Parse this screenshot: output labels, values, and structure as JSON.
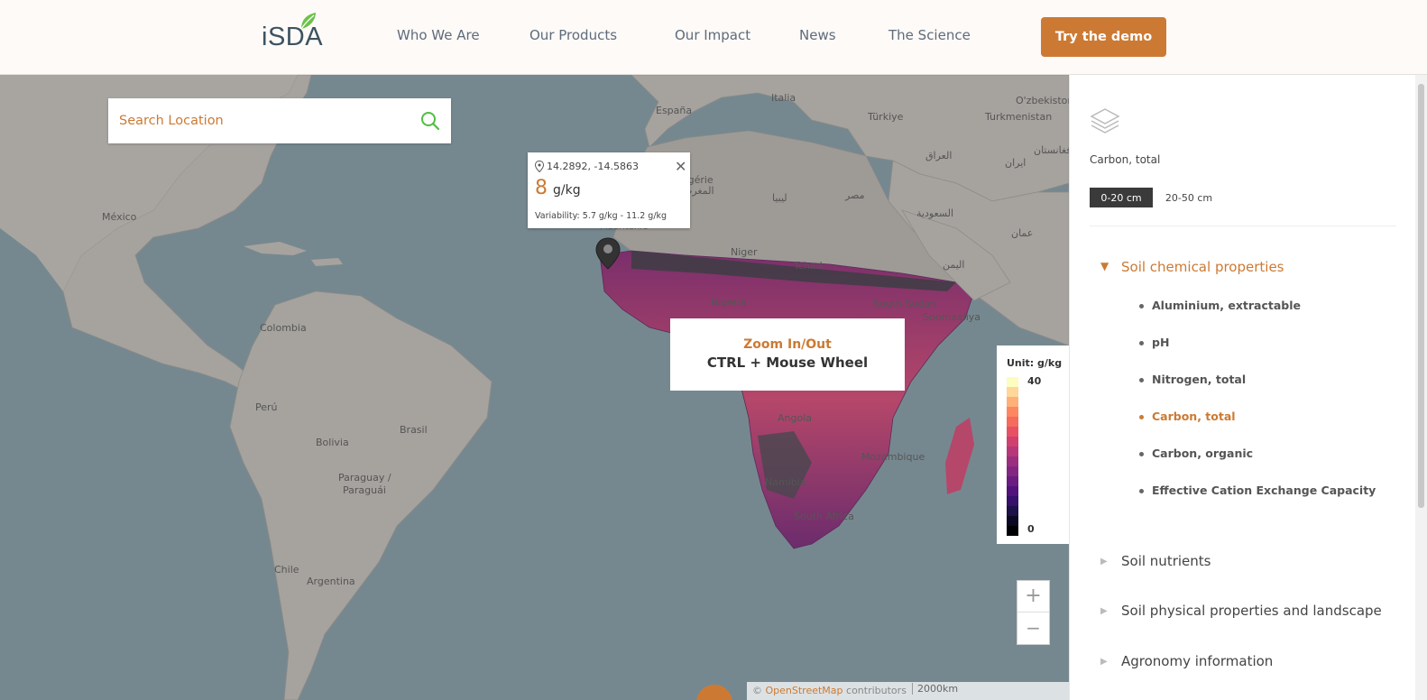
{
  "header": {
    "logo_text": "iSDA",
    "nav": [
      "Who We Are",
      "Our Products",
      "Our Impact",
      "News",
      "The Science"
    ],
    "cta": "Try the demo"
  },
  "search": {
    "placeholder": "Search Location",
    "icon": "search-icon"
  },
  "map_labels": [
    {
      "text": "Italia",
      "id": "italia"
    },
    {
      "text": "España",
      "id": "espana"
    },
    {
      "text": "Türkiye",
      "id": "turkiye"
    },
    {
      "text": "O'zbekiston",
      "id": "uzbek"
    },
    {
      "text": "Turkmenistan",
      "id": "turkmen"
    },
    {
      "text": "México",
      "id": "mexico"
    },
    {
      "text": "Colombia",
      "id": "colombia"
    },
    {
      "text": "Perú",
      "id": "peru"
    },
    {
      "text": "Bolivia",
      "id": "bolivia"
    },
    {
      "text": "Brasil",
      "id": "brasil"
    },
    {
      "text": "Paraguay /",
      "id": "paraguay1"
    },
    {
      "text": "Paraguái",
      "id": "paraguay2"
    },
    {
      "text": "Chile",
      "id": "chile"
    },
    {
      "text": "Argentina",
      "id": "argentina"
    },
    {
      "text": "ليبيا",
      "id": "libya"
    },
    {
      "text": "مصر",
      "id": "egypt"
    },
    {
      "text": "العراق",
      "id": "iraq"
    },
    {
      "text": "ایران",
      "id": "iran"
    },
    {
      "text": "افغانستان",
      "id": "afghan"
    },
    {
      "text": "السعودية",
      "id": "saudi"
    },
    {
      "text": "عمان",
      "id": "oman"
    },
    {
      "text": "اليمن",
      "id": "yemen"
    },
    {
      "text": "Algérie",
      "id": "algerie"
    },
    {
      "text": "المغرب",
      "id": "morocco"
    },
    {
      "text": "Mauritanie",
      "id": "mauritanie"
    },
    {
      "text": "Niger",
      "id": "niger"
    },
    {
      "text": "Tchad",
      "id": "tchad"
    },
    {
      "text": "South Sudan",
      "id": "southsudan"
    },
    {
      "text": "Soomaaliya",
      "id": "somalia"
    },
    {
      "text": "Nigeria",
      "id": "nigeria"
    },
    {
      "text": "Angola",
      "id": "angola"
    },
    {
      "text": "Namibia",
      "id": "namibia"
    },
    {
      "text": "South Africa",
      "id": "southafrica"
    },
    {
      "text": "Mozambique",
      "id": "mozambique"
    }
  ],
  "popup": {
    "coords": "14.2892, -14.5863",
    "value": "8",
    "unit": "g/kg",
    "variability": "Variability: 5.7 g/kg - 11.2 g/kg"
  },
  "zoom_hint": {
    "title": "Zoom In/Out",
    "text": "CTRL + Mouse Wheel"
  },
  "legend": {
    "title": "Unit: g/kg",
    "max": "40",
    "min": "0",
    "colors": [
      "#fcfdbf",
      "#fed799",
      "#feb078",
      "#fc8761",
      "#f56b5c",
      "#e75263",
      "#d0416f",
      "#b73779",
      "#9c2e7f",
      "#832681",
      "#6a1c81",
      "#51127c",
      "#36106b",
      "#1d1147",
      "#0a0822",
      "#000004"
    ]
  },
  "zoom": {
    "in": "+",
    "out": "−"
  },
  "attribution": {
    "prefix": "© ",
    "link": "OpenStreetMap",
    "suffix": " contributors",
    "scale": "2000km"
  },
  "panel": {
    "layer_icon": "layers-icon",
    "layer_title": "Carbon, total",
    "depth_tabs": [
      "0-20 cm",
      "20-50 cm"
    ],
    "active_depth": 0,
    "sections": [
      {
        "label": "Soil chemical properties",
        "open": true,
        "items": [
          "Aluminium, extractable",
          "pH",
          "Nitrogen, total",
          "Carbon, total",
          "Carbon, organic",
          "Effective Cation Exchange Capacity"
        ],
        "active_item": "Carbon, total"
      },
      {
        "label": "Soil nutrients",
        "open": false
      },
      {
        "label": "Soil physical properties and landscape",
        "open": false
      },
      {
        "label": "Agronomy information",
        "open": false
      }
    ]
  }
}
